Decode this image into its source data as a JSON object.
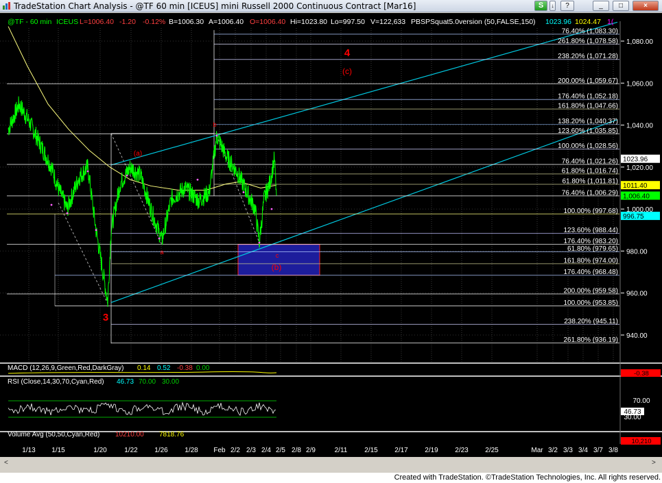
{
  "window": {
    "title": "TradeStation Chart Analysis - @TF 60 min [ICEUS] mini Russell 2000 Continuous Contract [Mar16]",
    "buttons": [
      "S",
      "↓",
      "?",
      "_",
      "□",
      "×"
    ]
  },
  "header": {
    "symbol": "@TF - 60 min",
    "exchange": "ICEUS",
    "last": "L=1006.40",
    "change": "-1.20",
    "change_pct": "-0.12%",
    "bid": "B=1006.30",
    "ask": "A=1006.40",
    "open": "O=1006.40",
    "high": "Hi=1023.80",
    "low": "Lo=997.50",
    "volume": "V=122,633",
    "indicator": "PBSPSquat5.0version (50,FALSE,150)",
    "ind_v1": "1023.96",
    "ind_v2": "1024.47",
    "ind_v3": "1("
  },
  "price_axis": {
    "ticks": [
      "1,080.00",
      "1,060.00",
      "1,040.00",
      "1,020.00",
      "1,000.00",
      "980.00",
      "960.00",
      "940.00"
    ],
    "badges": [
      {
        "text": "1023.96",
        "bg": "#ffffff",
        "fg": "#000000",
        "price": 1023.96
      },
      {
        "text": "1011.40",
        "bg": "#ffff00",
        "fg": "#000000",
        "price": 1011.4
      },
      {
        "text": "1,006.40",
        "bg": "#00ff00",
        "fg": "#000000",
        "price": 1006.4
      },
      {
        "text": "996.75",
        "bg": "#00ffff",
        "fg": "#000000",
        "price": 996.75
      }
    ]
  },
  "fib_levels": [
    {
      "label": "76.40% (1,083.30)",
      "price": 1083.3
    },
    {
      "label": "261.80% (1,078.58)",
      "price": 1078.58
    },
    {
      "label": "238.20% (1,071.28)",
      "price": 1071.28
    },
    {
      "label": "200.00% (1,059.67)",
      "price": 1059.67
    },
    {
      "label": "176.40% (1,052.18)",
      "price": 1052.18
    },
    {
      "label": "161.80% (1,047.66)",
      "price": 1047.66
    },
    {
      "label": "138.20% (1,040.37)",
      "price": 1040.37
    },
    {
      "label": "123.60% (1,035.85)",
      "price": 1035.85
    },
    {
      "label": "100.00% (1,028.56)",
      "price": 1028.56
    },
    {
      "label": "76.40% (1,021.26)",
      "price": 1021.26
    },
    {
      "label": "61.80% (1,016.74)",
      "price": 1016.74
    },
    {
      "label": "61.80% (1,011.81)",
      "price": 1011.81
    },
    {
      "label": "76.40% (1,006.29)",
      "price": 1006.29
    },
    {
      "label": "100.00% (997.68)",
      "price": 997.68
    },
    {
      "label": "123.60% (988.44)",
      "price": 988.44
    },
    {
      "label": "176.40% (983.20)",
      "price": 983.2
    },
    {
      "label": "61.80% (979.65)",
      "price": 979.65
    },
    {
      "label": "161.80% (974.00)",
      "price": 974.0
    },
    {
      "label": "176.40% (968.48)",
      "price": 968.48
    },
    {
      "label": "200.00% (959.58)",
      "price": 959.58
    },
    {
      "label": "100.00% (953.85)",
      "price": 953.85
    },
    {
      "label": "238.20% (945.11)",
      "price": 945.11
    },
    {
      "label": "261.80% (936.19)",
      "price": 936.19
    }
  ],
  "wave_labels": [
    {
      "text": "4",
      "color": "#ff0000"
    },
    {
      "text": "(c)",
      "color": "#ff0000"
    },
    {
      "text": "(a)",
      "color": "#ff0000"
    },
    {
      "text": "(b)",
      "color": "#ff0000"
    },
    {
      "text": "3",
      "color": "#ff0000"
    },
    {
      "text": "a",
      "color": "#ff0000"
    },
    {
      "text": "b",
      "color": "#ff0000"
    },
    {
      "text": "c",
      "color": "#ff0000"
    }
  ],
  "macd": {
    "label": "MACD (12,26,9,Green,Red,DarkGray)",
    "v1": "0.14",
    "v2": "0.52",
    "v3": "-0.38",
    "v4": "0.00",
    "badge": "-0.38"
  },
  "rsi": {
    "label": "RSI (Close,14,30,70,Cyan,Red)",
    "v1": "46.73",
    "v2": "70.00",
    "v3": "30.00",
    "ticks": [
      "70.00",
      "30.00"
    ],
    "badge": "46.73"
  },
  "volume": {
    "label": "Volume Avg (50,50,Cyan,Red)",
    "v1": "10210.00",
    "v2": "7818.76",
    "badge": "10,210"
  },
  "x_axis": {
    "dates": [
      "1/13",
      "1/15",
      "1/20",
      "1/22",
      "1/26",
      "1/28",
      "Feb",
      "2/2",
      "2/3",
      "2/4",
      "2/5",
      "2/8",
      "2/9",
      "2/11",
      "2/15",
      "2/17",
      "2/19",
      "2/23",
      "2/25",
      "Mar",
      "3/2",
      "3/3",
      "3/4",
      "3/7",
      "3/8"
    ]
  },
  "footer": {
    "credit": "Created with TradeStation. ©TradeStation Technologies, Inc. All rights reserved."
  },
  "chart_data": {
    "type": "line",
    "title": "@TF 60 min [ICEUS] mini Russell 2000 Continuous Contract [Mar16]",
    "xlabel": "",
    "ylabel": "",
    "ylim": [
      930,
      1095
    ],
    "grid": true,
    "x": [
      "1/13",
      "1/15",
      "1/20",
      "1/22",
      "1/26",
      "1/28",
      "Feb",
      "2/2",
      "2/3",
      "2/4"
    ],
    "series": [
      {
        "name": "@TF - 60 min",
        "color": "#00ff00",
        "values": [
          1042,
          1010,
          956,
          1020,
          985,
          1008,
          1035,
          1005,
          984,
          1023.8
        ]
      }
    ]
  }
}
